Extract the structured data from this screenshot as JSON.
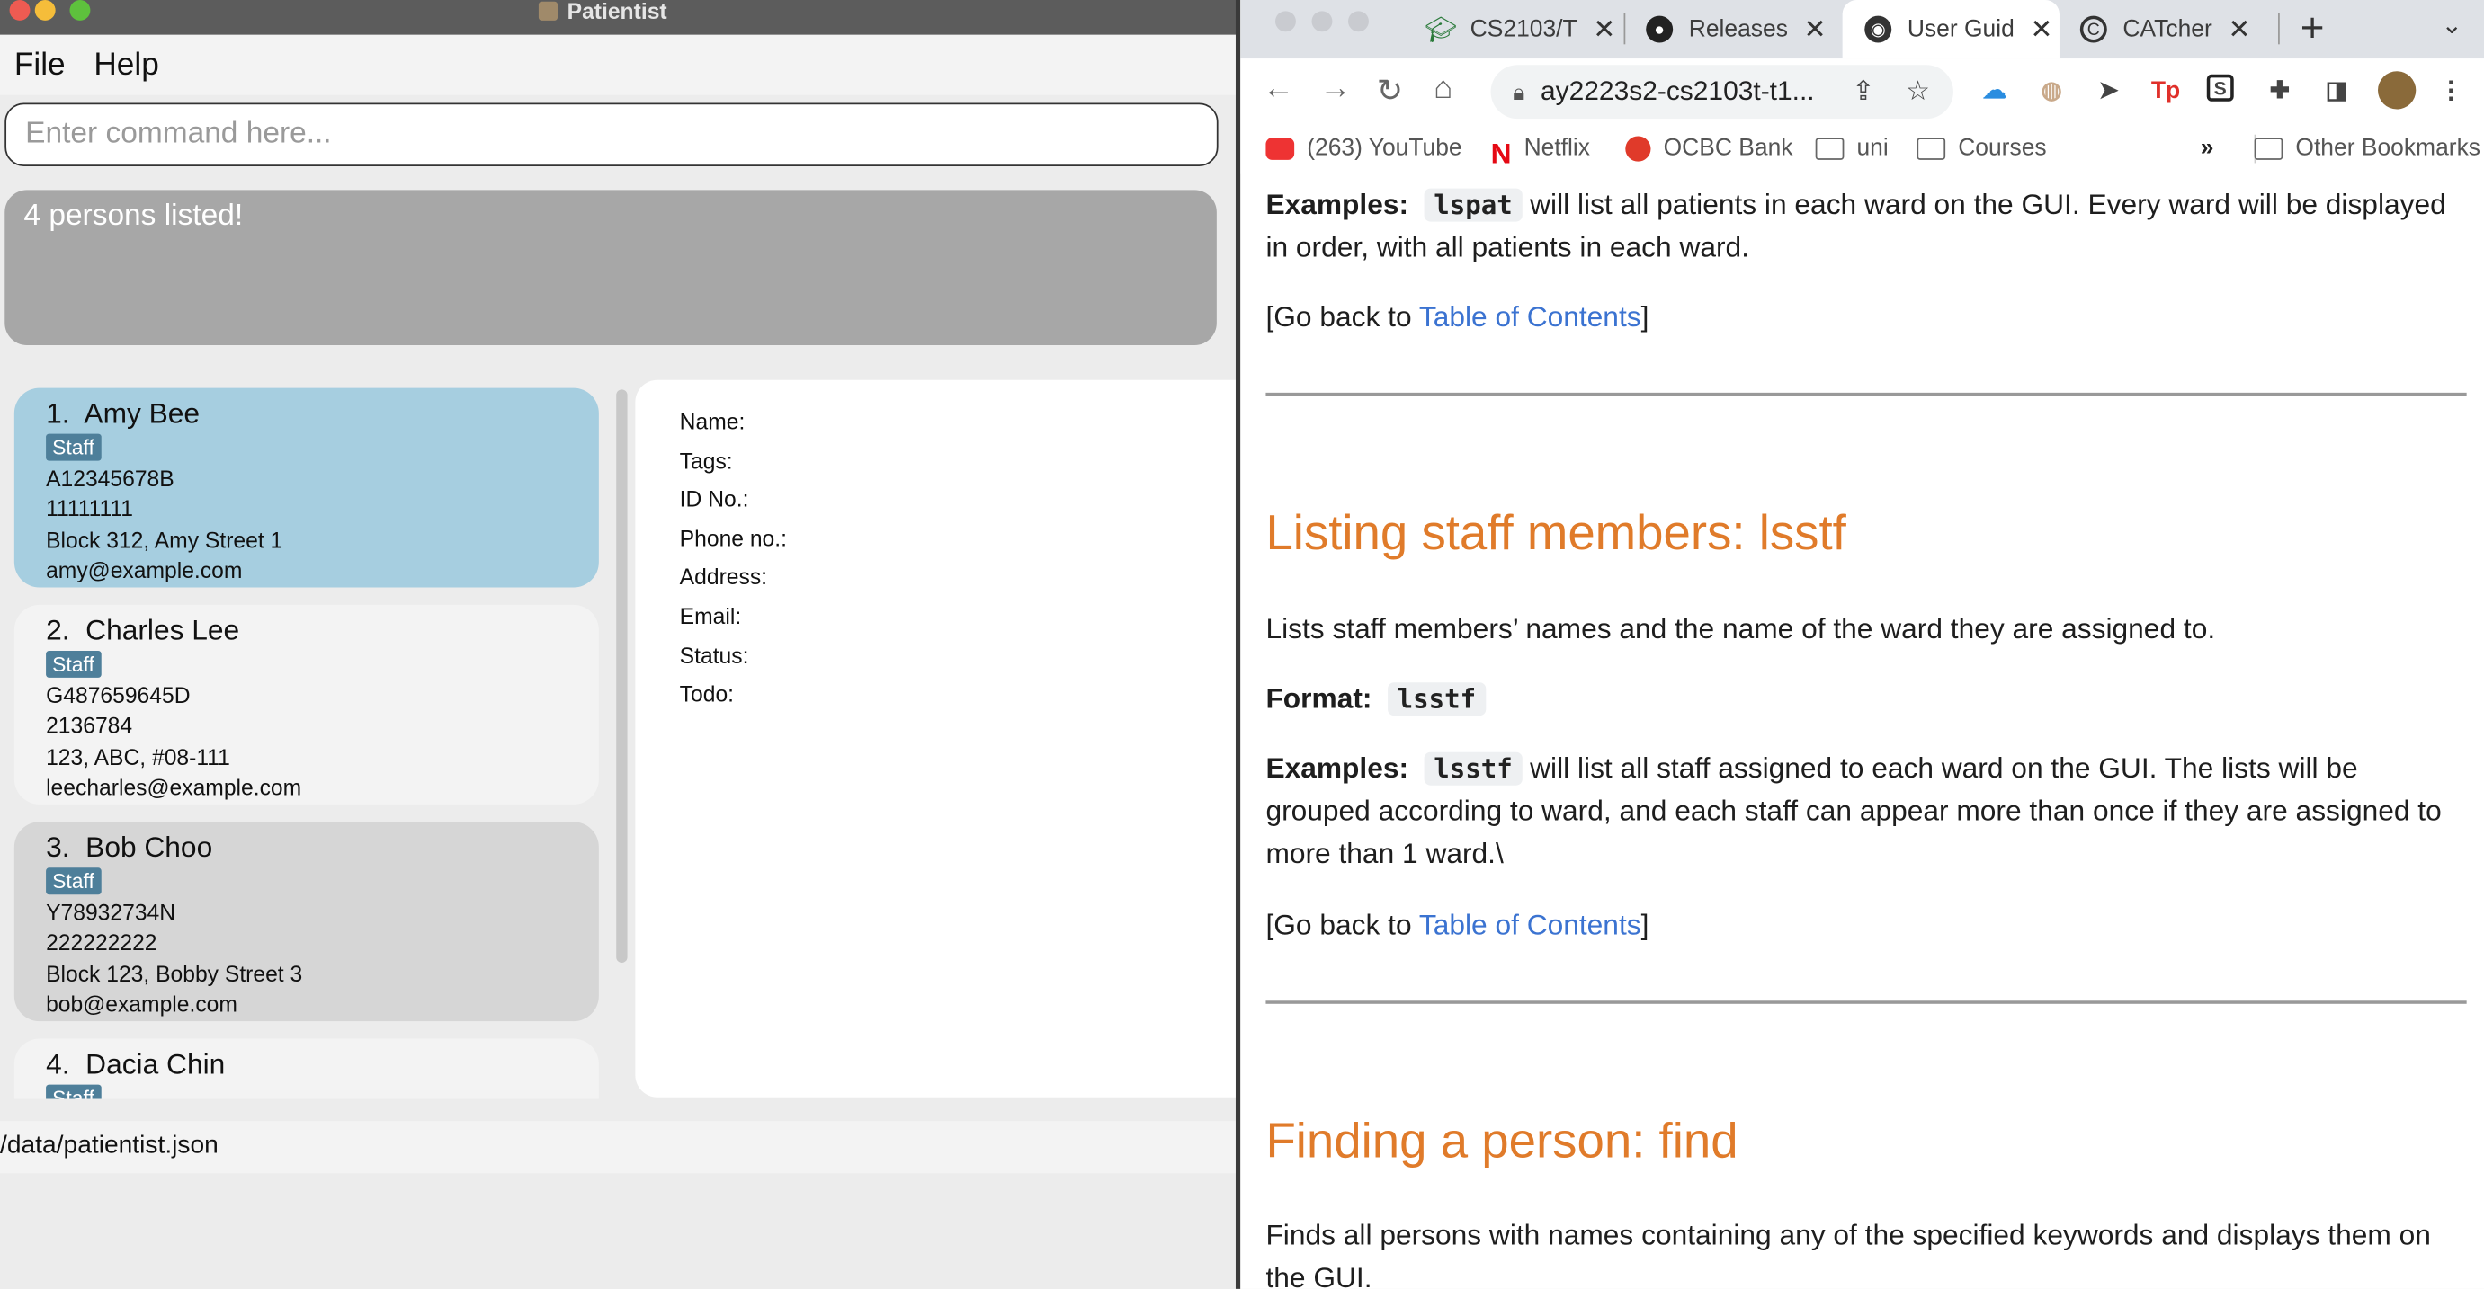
{
  "app": {
    "title": "Patientist",
    "menu": [
      "File",
      "Help"
    ],
    "command_placeholder": "Enter command here...",
    "result_text": "4 persons listed!",
    "persons": [
      {
        "index": "1.",
        "name": "Amy Bee",
        "tag": "Staff",
        "id": "A12345678B",
        "phone": "11111111",
        "address": "Block 312, Amy Street 1",
        "email": "amy@example.com"
      },
      {
        "index": "2.",
        "name": "Charles Lee",
        "tag": "Staff",
        "id": "G487659645D",
        "phone": "2136784",
        "address": "123, ABC, #08-111",
        "email": "leecharles@example.com"
      },
      {
        "index": "3.",
        "name": "Bob Choo",
        "tag": "Staff",
        "id": "Y78932734N",
        "phone": "222222222",
        "address": "Block 123, Bobby Street 3",
        "email": "bob@example.com"
      },
      {
        "index": "4.",
        "name": "Dacia Chin",
        "tag": "Staff",
        "id": "",
        "phone": "",
        "address": "",
        "email": ""
      }
    ],
    "detail_labels": [
      "Name:",
      "Tags:",
      "ID No.:",
      "Phone no.:",
      "Address:",
      "Email:",
      "Status:",
      "Todo:"
    ],
    "status_path": "/data/patientist.json"
  },
  "browser": {
    "tabs": [
      {
        "label": "CS2103/T",
        "icon": "graduation-cap-icon"
      },
      {
        "label": "Releases",
        "icon": "github-icon"
      },
      {
        "label": "User Guid",
        "icon": "globe-icon"
      },
      {
        "label": "CATcher",
        "icon": "catcher-icon"
      }
    ],
    "url": "ay2223s2-cs2103t-t1...",
    "bookmarks": [
      "(263) YouTube",
      "Netflix",
      "OCBC Bank",
      "uni",
      "Courses"
    ],
    "bookmarks_overflow": "»",
    "other_bookmarks": "Other Bookmarks",
    "page": {
      "ex1_label": "Examples:",
      "ex1_code": "lspat",
      "ex1_text": " will list all patients in each ward on the GUI. Every ward will be displayed in order, with all patients in each ward.",
      "back1_pre": "[Go back to ",
      "back_link": "Table of Contents",
      "back_post": "]",
      "h_lsstf": "Listing staff members: lsstf",
      "lsstf_desc": "Lists staff members’ names and the name of the ward they are assigned to.",
      "format_label": "Format:",
      "format_code": "lsstf",
      "ex2_label": "Examples:",
      "ex2_code": "lsstf",
      "ex2_text": " will list all staff assigned to each ward on the GUI. The lists will be grouped according to ward, and each staff can appear more than once if they are assigned to more than 1 ward.\\",
      "h_find": "Finding a person: find",
      "find_desc": "Finds all persons with names containing any of the specified keywords and displays them on the GUI."
    }
  }
}
